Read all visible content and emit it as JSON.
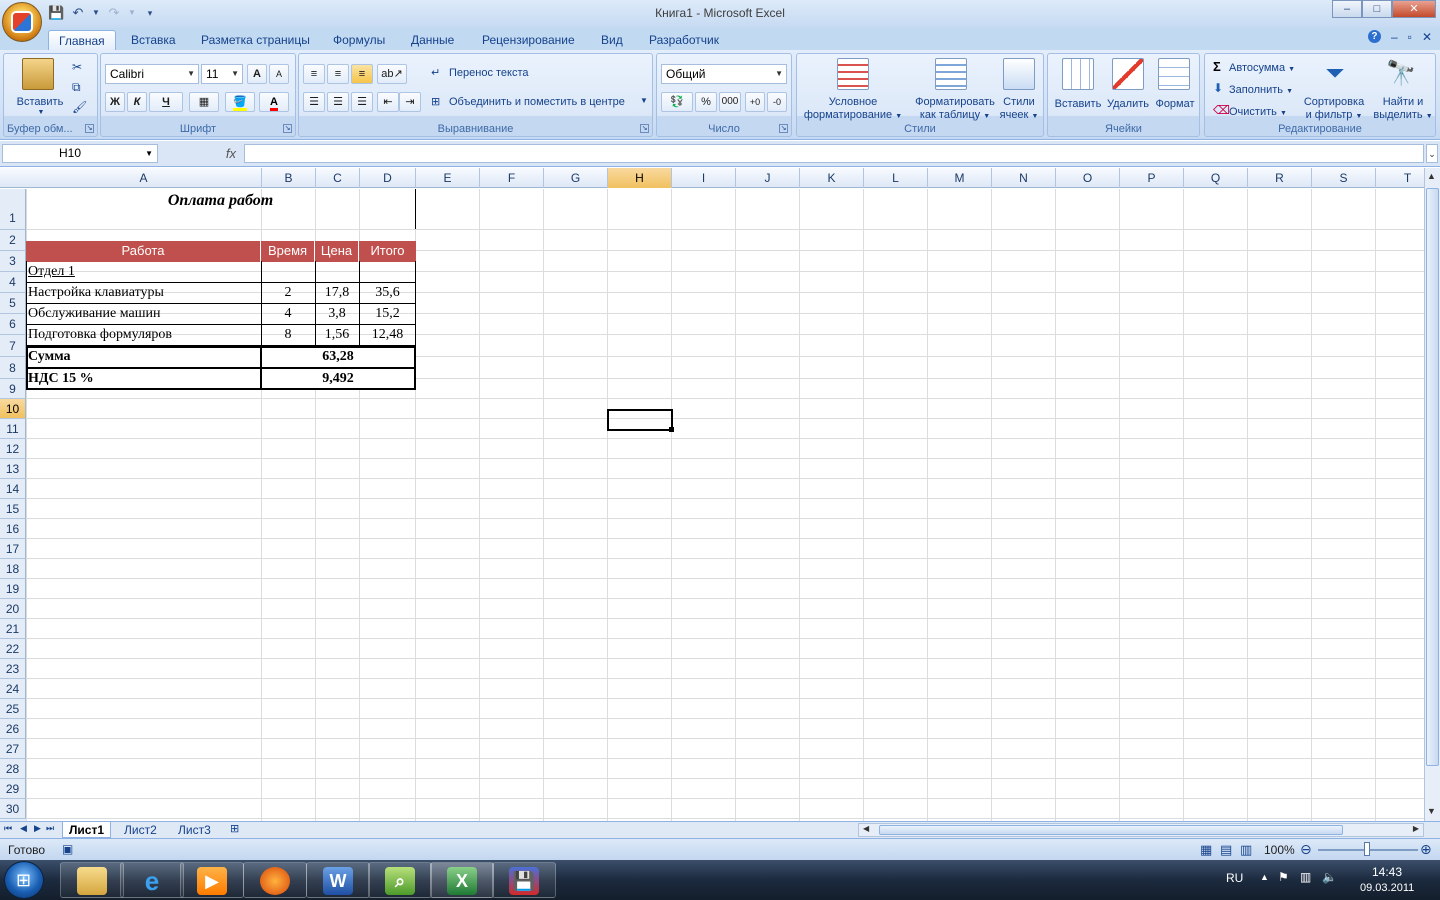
{
  "window": {
    "title": "Книга1 - Microsoft Excel",
    "controls": [
      "–",
      "□",
      "✕"
    ]
  },
  "ribbon_tabs": [
    {
      "label": "Главная",
      "active": true
    },
    {
      "label": "Вставка"
    },
    {
      "label": "Разметка страницы"
    },
    {
      "label": "Формулы"
    },
    {
      "label": "Данные"
    },
    {
      "label": "Рецензирование"
    },
    {
      "label": "Вид"
    },
    {
      "label": "Разработчик"
    }
  ],
  "ribbon": {
    "clipboard": {
      "label": "Буфер обм...",
      "paste": "Вставить"
    },
    "font": {
      "label": "Шрифт",
      "family": "Calibri",
      "size": "11",
      "bold": "Ж",
      "italic": "К",
      "underline": "Ч",
      "grow": "A",
      "shrink": "A",
      "color_a": "A"
    },
    "alignment": {
      "label": "Выравнивание",
      "wrap": "Перенос текста",
      "merge": "Объединить и поместить в центре"
    },
    "number": {
      "label": "Число",
      "format": "Общий",
      "percent": "%",
      "thousands": "000"
    },
    "styles": {
      "label": "Стили",
      "cond_line1": "Условное",
      "cond_line2": "форматирование",
      "table_line1": "Форматировать",
      "table_line2": "как таблицу",
      "cell_line1": "Стили",
      "cell_line2": "ячеек"
    },
    "cells": {
      "label": "Ячейки",
      "insert": "Вставить",
      "delete": "Удалить",
      "format": "Формат"
    },
    "editing": {
      "label": "Редактирование",
      "autosum": "Автосумма",
      "fill": "Заполнить",
      "clear": "Очистить",
      "sort_line1": "Сортировка",
      "sort_line2": "и фильтр",
      "find_line1": "Найти и",
      "find_line2": "выделить"
    }
  },
  "formula_bar": {
    "name_box": "H10",
    "fx": "fx",
    "formula": ""
  },
  "columns": [
    "A",
    "B",
    "C",
    "D",
    "E",
    "F",
    "G",
    "H",
    "I",
    "J",
    "K",
    "L",
    "M",
    "N",
    "O",
    "P",
    "Q",
    "R",
    "S",
    "T"
  ],
  "selected_column": "H",
  "rows": [
    "1",
    "2",
    "3",
    "4",
    "5",
    "6",
    "7",
    "8",
    "9",
    "10",
    "11",
    "12",
    "13",
    "14",
    "15",
    "16",
    "17",
    "18",
    "19",
    "20",
    "21",
    "22",
    "23",
    "24",
    "25",
    "26",
    "27",
    "28",
    "29",
    "30"
  ],
  "selected_row": "10",
  "sheet": {
    "title": "Оплата работ",
    "headers": [
      "Работа",
      "Время",
      "Цена",
      "Итого"
    ],
    "dept": "Отдел 1",
    "items": [
      {
        "name": "Настройка клавиатуры",
        "time": "2",
        "price": "17,8",
        "total": "35,6"
      },
      {
        "name": "Обслуживание машин",
        "time": "4",
        "price": "3,8",
        "total": "15,2"
      },
      {
        "name": "Подготовка формуляров",
        "time": "8",
        "price": "1,56",
        "total": "12,48"
      }
    ],
    "sum_label": "Сумма",
    "sum_value": "63,28",
    "vat_label": "НДС 15 %",
    "vat_value": "9,492"
  },
  "sheet_tabs": [
    "Лист1",
    "Лист2",
    "Лист3"
  ],
  "status": {
    "ready": "Готово",
    "zoom": "100%"
  },
  "taskbar": {
    "lang": "RU",
    "time": "14:43",
    "date": "09.03.2011"
  },
  "colors": {
    "header_fill": "#c0504d",
    "accent": "#15428b",
    "selection": "#f1c15f"
  }
}
